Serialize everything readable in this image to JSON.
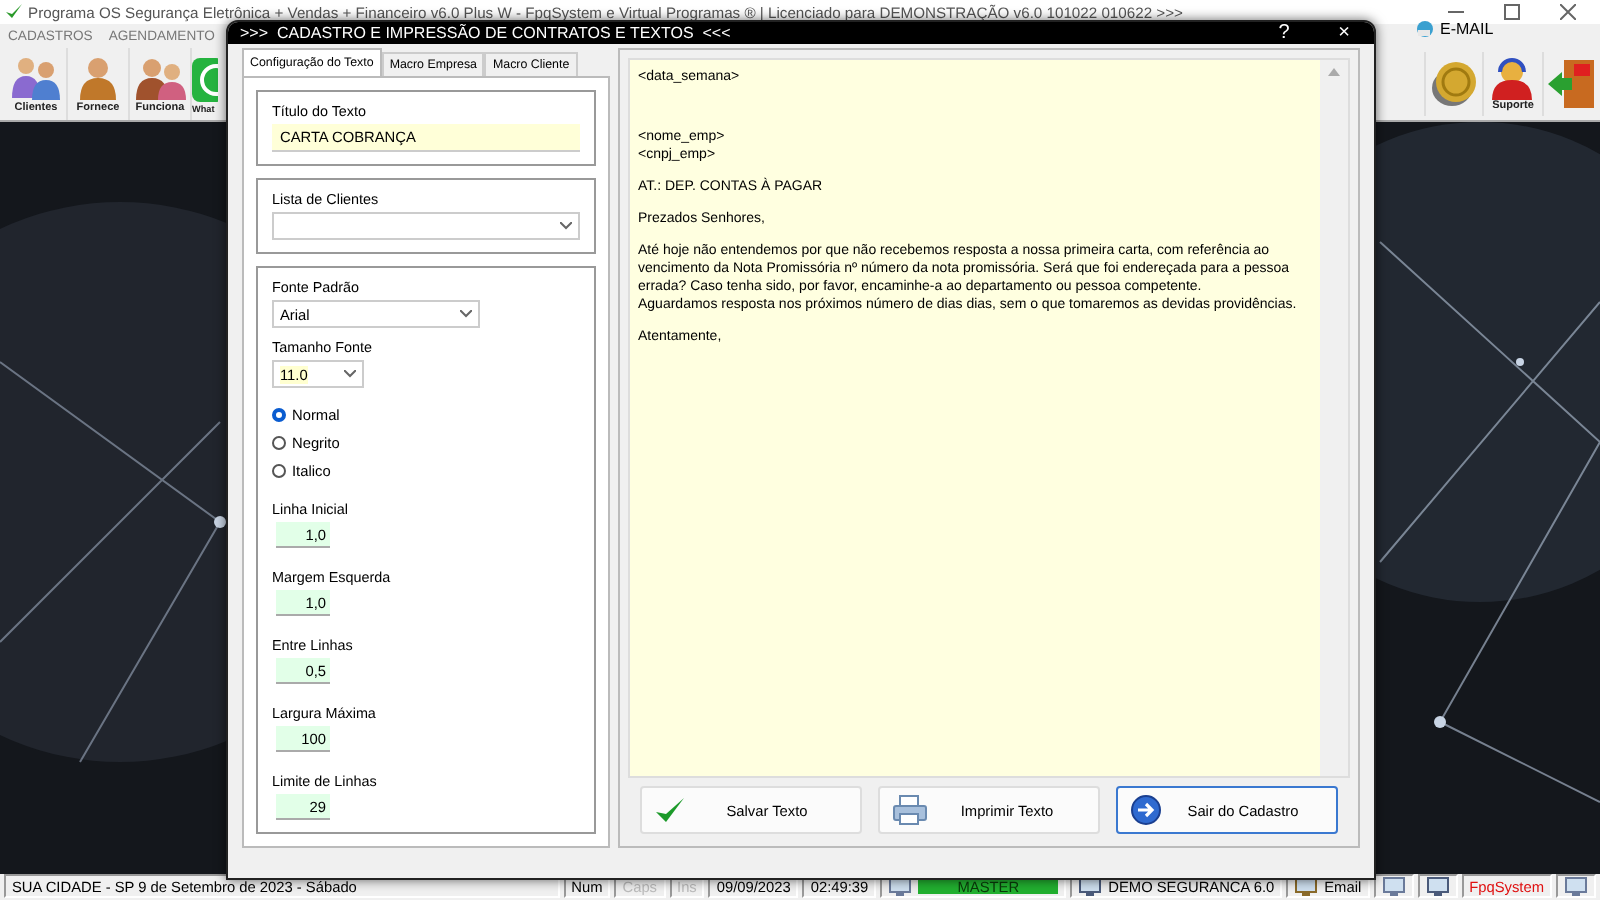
{
  "main_window": {
    "title": "Programa OS Segurança Eletrônica + Vendas + Financeiro v6.0 Plus W - FpqSystem e Virtual Programas ® | Licenciado para  DEMONSTRAÇÃO v6.0 101022 010622 >>>",
    "menu": [
      "CADASTROS",
      "AGENDAMENTO"
    ],
    "toolbar_left": [
      {
        "kind": "clients",
        "label": "Clientes"
      },
      {
        "kind": "supplier",
        "label": "Fornece"
      },
      {
        "kind": "employee",
        "label": "Funciona"
      },
      {
        "kind": "whatsapp",
        "label": "What"
      }
    ],
    "email_label": "E-MAIL",
    "toolbar_right": [
      {
        "kind": "coin"
      },
      {
        "kind": "support",
        "label": "Suporte"
      },
      {
        "kind": "exit"
      }
    ]
  },
  "dialog": {
    "title": ">>>  CADASTRO E IMPRESSÃO DE CONTRATOS E TEXTOS  <<<",
    "help": "?",
    "close": "×",
    "tabs": [
      {
        "label": "Configuração do Texto",
        "selected": true
      },
      {
        "label": "Macro Empresa",
        "selected": false
      },
      {
        "label": "Macro Cliente",
        "selected": false
      }
    ],
    "text_title": {
      "label": "Título do Texto",
      "value": "CARTA COBRANÇA"
    },
    "client_list": {
      "label": "Lista de Clientes"
    },
    "font": {
      "label": "Fonte Padrão",
      "value": "Arial"
    },
    "font_size": {
      "label": "Tamanho Fonte",
      "value": "11.0"
    },
    "styles": [
      {
        "label": "Normal",
        "selected": true
      },
      {
        "label": "Negrito",
        "selected": false
      },
      {
        "label": "Italico",
        "selected": false
      }
    ],
    "numbers": [
      {
        "label": "Linha Inicial",
        "value": "1,0"
      },
      {
        "label": "Margem Esquerda",
        "value": "1,0"
      },
      {
        "label": "Entre Linhas",
        "value": "0,5"
      },
      {
        "label": "Largura Máxima",
        "value": "100"
      },
      {
        "label": "Limite de Linhas",
        "value": "29"
      }
    ],
    "letter": [
      {
        "lines": [
          "<data_semana>"
        ]
      },
      {
        "lines": [
          "<nome_emp>",
          "<cnpj_emp>"
        ]
      },
      {
        "lines": [
          "AT.: DEP. CONTAS À PAGAR"
        ]
      },
      {
        "lines": [
          "Prezados Senhores,"
        ]
      },
      {
        "lines": [
          "Até hoje não entendemos por que não recebemos resposta a nossa primeira carta, com referência ao vencimento da Nota Promissória nº número da nota promissória. Será que foi endereçada para a pessoa errada? Caso tenha sido, por favor, encaminhe-a ao departamento ou pessoa competente.",
          "Aguardamos resposta nos próximos número de dias dias, sem o que tomaremos as devidas providências."
        ]
      },
      {
        "lines": [
          "Atentamente,"
        ]
      }
    ],
    "buttons": [
      {
        "kind": "save",
        "label": "Salvar Texto",
        "focused": false
      },
      {
        "kind": "print",
        "label": "Imprimir Texto",
        "focused": false
      },
      {
        "kind": "exit",
        "label": "Sair do Cadastro",
        "focused": true
      }
    ]
  },
  "status_bar": [
    {
      "kind": "text",
      "text": "SUA CIDADE - SP  9 de Setembro de 2023 - Sábado",
      "disabled": false
    },
    {
      "kind": "text",
      "text": "Num",
      "disabled": false
    },
    {
      "kind": "text",
      "text": "Caps",
      "disabled": true
    },
    {
      "kind": "text",
      "text": "Ins",
      "disabled": true
    },
    {
      "kind": "text",
      "text": "09/09/2023",
      "disabled": false
    },
    {
      "kind": "text",
      "text": "02:49:39",
      "disabled": false
    },
    {
      "kind": "meter",
      "text": "MASTER"
    },
    {
      "kind": "icon-text",
      "text": "DEMO SEGURANCA 6.0"
    },
    {
      "kind": "icon-text",
      "text": "Email"
    },
    {
      "kind": "icon"
    },
    {
      "kind": "icon"
    },
    {
      "kind": "brand",
      "text": "FpqSystem"
    },
    {
      "kind": "icon"
    }
  ]
}
